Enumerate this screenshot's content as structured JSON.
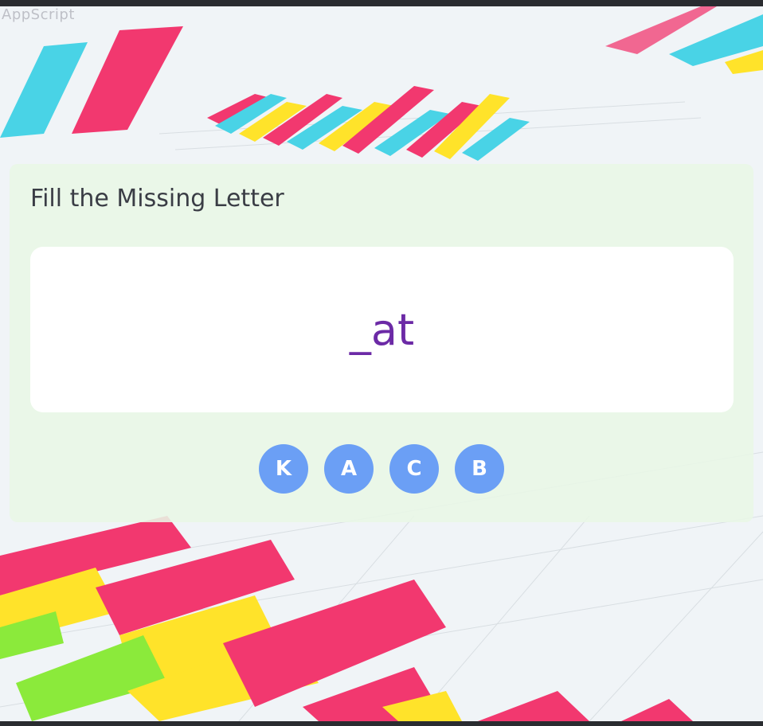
{
  "app": {
    "watermark": "AppScript"
  },
  "quiz": {
    "title": "Fill the Missing Letter",
    "word": "_at",
    "options": [
      "K",
      "A",
      "C",
      "B"
    ]
  },
  "theme": {
    "word_color": "#6c2aa6",
    "option_color": "#6b9ff5",
    "card_color": "#e8f7e6"
  },
  "background": {
    "image": "colorful bar charts"
  }
}
